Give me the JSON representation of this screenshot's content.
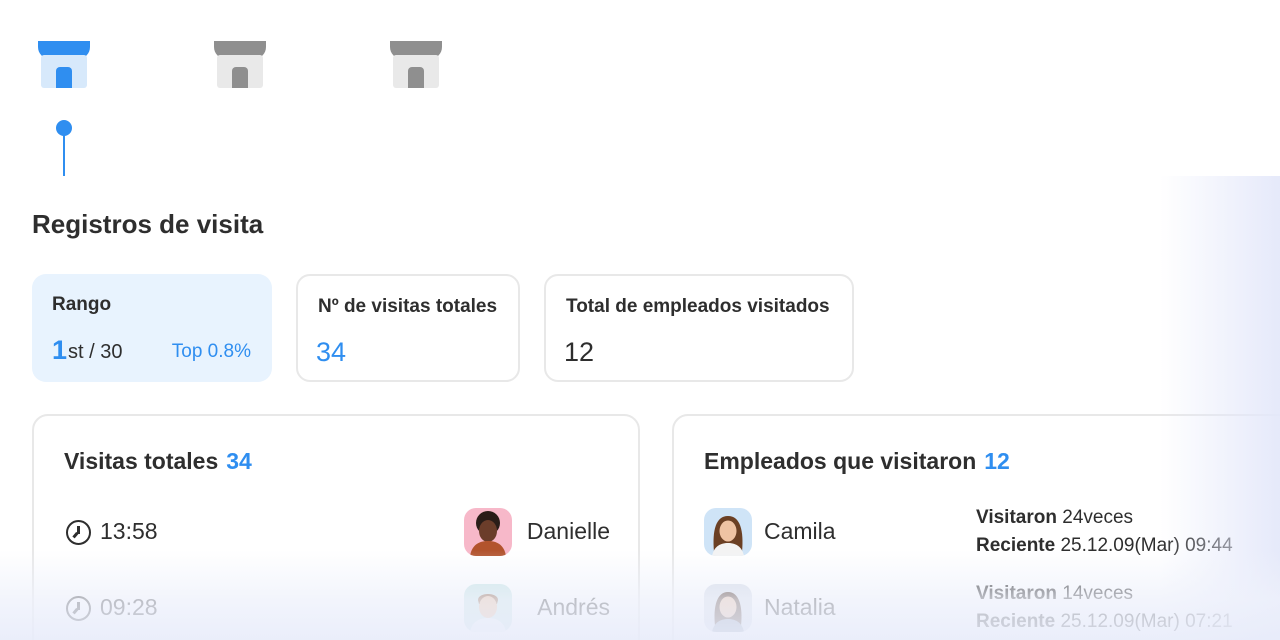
{
  "stores": [
    {
      "name": "store-1",
      "active": true
    },
    {
      "name": "store-2",
      "active": false
    },
    {
      "name": "store-3",
      "active": false
    }
  ],
  "title": "Registros de visita",
  "stats": {
    "rank": {
      "label": "Rango",
      "position": "1",
      "suffix": "st / 30",
      "top": "Top 0.8%"
    },
    "total_visits": {
      "label": "Nº de visitas totales",
      "value": "34"
    },
    "employees_visited": {
      "label": "Total de empleados visitados",
      "value": "12"
    }
  },
  "visits_panel": {
    "title": "Visitas totales",
    "count": "34",
    "rows": [
      {
        "time": "13:58",
        "name": "Danielle"
      },
      {
        "time": "09:28",
        "name": "Andrés"
      }
    ]
  },
  "employees_panel": {
    "title": "Empleados que visitaron",
    "count": "12",
    "rows": [
      {
        "name": "Camila",
        "visits_label": "Visitaron",
        "visits_value": "24veces",
        "recent_label": "Reciente",
        "recent_value": "25.12.09(Mar) 09:44"
      },
      {
        "name": "Natalia",
        "visits_label": "Visitaron",
        "visits_value": "14veces",
        "recent_label": "Reciente",
        "recent_value": "25.12.09(Mar) 07:21"
      }
    ]
  },
  "colors": {
    "accent": "#2f8ef0",
    "inactive": "#8f8f8f",
    "rank_bg": "#e8f3fe"
  }
}
